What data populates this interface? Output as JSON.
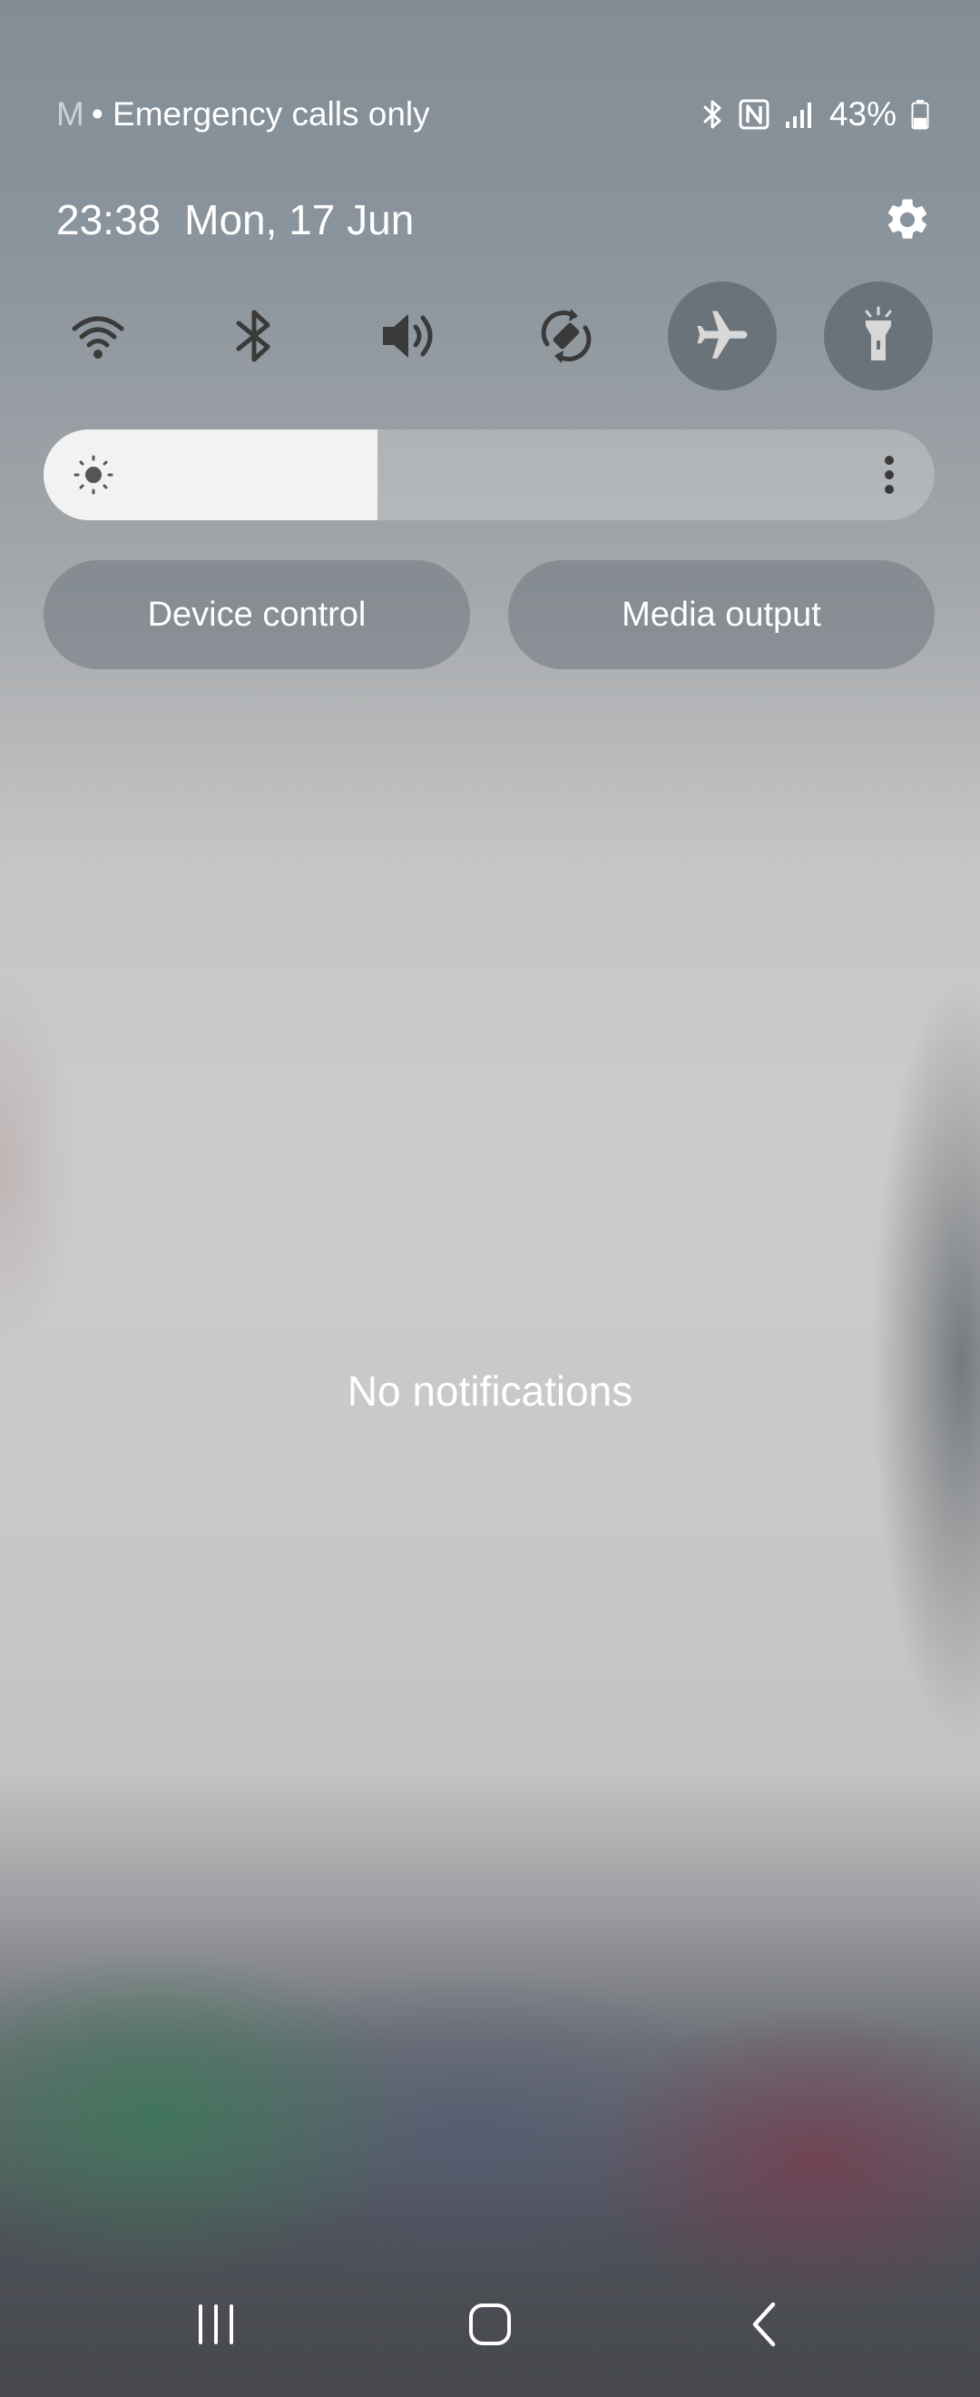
{
  "status_bar": {
    "carrier_partial": "M",
    "carrier_text": "• Emergency calls only",
    "battery_percent": "43%",
    "battery_level": 0.43,
    "icons": [
      "bluetooth-icon",
      "nfc-icon",
      "signal-icon",
      "battery-icon"
    ]
  },
  "header": {
    "time": "23:38",
    "date": "Mon, 17 Jun",
    "settings_icon": "gear-icon"
  },
  "quick_toggles": [
    {
      "name": "Wi-Fi",
      "icon": "wifi-icon",
      "state": "on"
    },
    {
      "name": "Bluetooth",
      "icon": "bluetooth-icon",
      "state": "on"
    },
    {
      "name": "Sound",
      "icon": "volume-icon",
      "state": "on"
    },
    {
      "name": "Auto rotate",
      "icon": "rotate-icon",
      "state": "on"
    },
    {
      "name": "Airplane mode",
      "icon": "airplane-icon",
      "state": "off"
    },
    {
      "name": "Torch",
      "icon": "flashlight-icon",
      "state": "off"
    }
  ],
  "brightness": {
    "level": 0.375,
    "icon": "sun-icon",
    "menu_icon": "more-vertical-icon"
  },
  "buttons": {
    "device_control": "Device control",
    "media_output": "Media output"
  },
  "notifications": {
    "empty_text": "No notifications"
  },
  "nav_bar": {
    "items": [
      "recents-icon",
      "home-icon",
      "back-icon"
    ]
  },
  "colors": {
    "toggle_on_bg": "#ffffff",
    "toggle_off_bg": "#6b737a",
    "icon_on": "#3a3a3a",
    "icon_off": "#d8d8d8"
  }
}
